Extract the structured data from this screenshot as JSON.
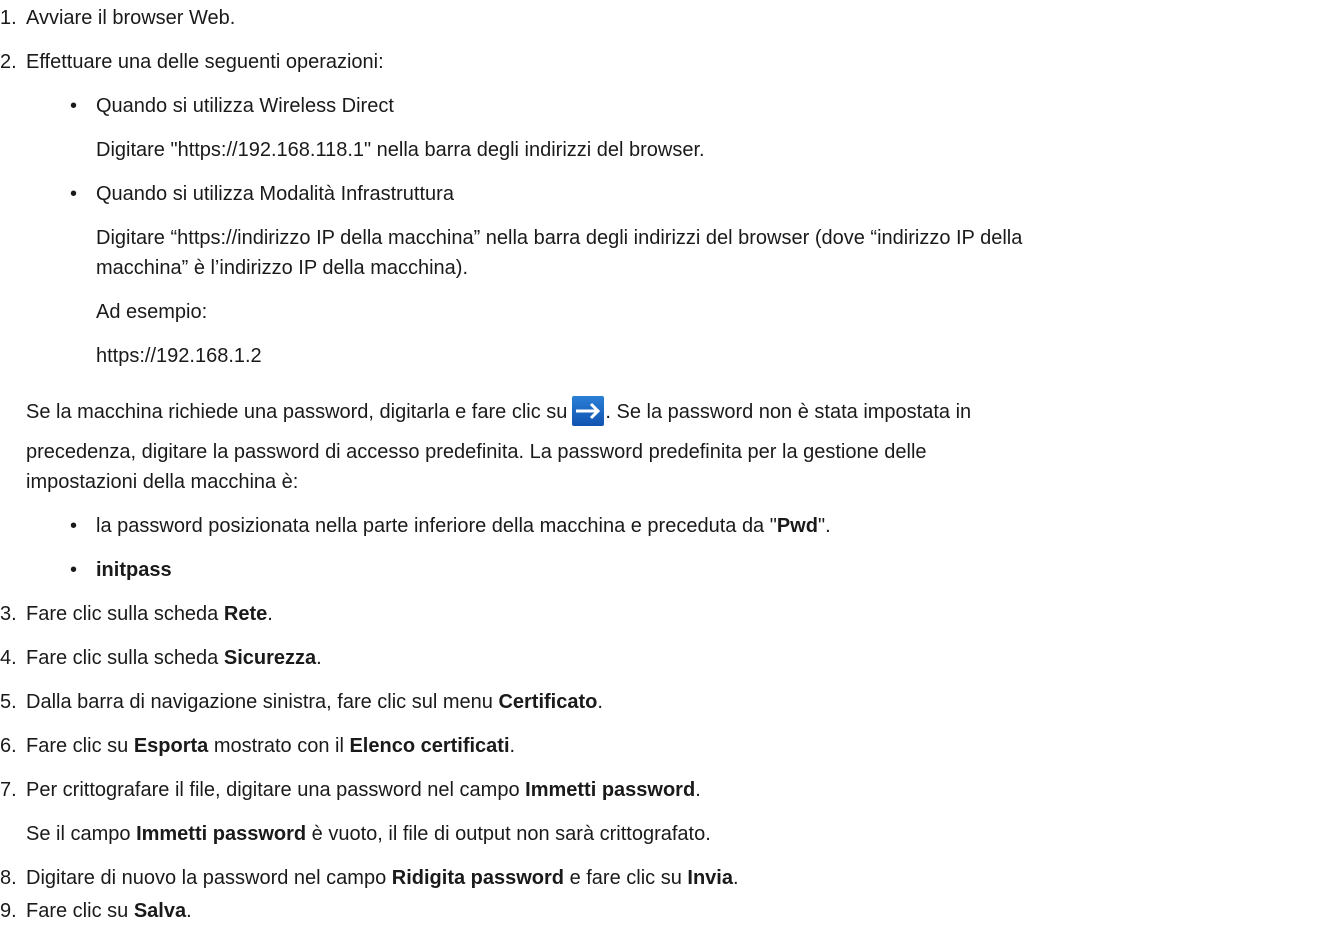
{
  "steps": {
    "s1": {
      "num": "1.",
      "text": "Avviare il browser Web."
    },
    "s2": {
      "num": "2.",
      "text": "Effettuare una delle seguenti operazioni:",
      "opt1_title": "Quando si utilizza Wireless Direct",
      "opt1_desc": "Digitare \"https://192.168.118.1\" nella barra degli indirizzi del browser.",
      "opt2_title": "Quando si utilizza Modalità Infrastruttura",
      "opt2_desc_1": "Digitare “https://indirizzo IP della macchina” nella barra degli indirizzi del browser (dove “indirizzo IP della",
      "opt2_desc_2": "macchina” è l’indirizzo IP della macchina).",
      "example_label": "Ad esempio:",
      "example_url": "https://192.168.1.2",
      "pwd_text_a": "Se la macchina richiede una password, digitarla e fare clic su",
      "pwd_text_b": ". Se la password non è stata impostata in",
      "pwd_text_c": "precedenza, digitare la password di accesso predefinita. La password predefinita per la gestione delle",
      "pwd_text_d": "impostazioni della macchina è:",
      "bullet1_a": "la password posizionata nella parte inferiore della macchina e preceduta da \"",
      "bullet1_b": "Pwd",
      "bullet1_c": "\".",
      "bullet2": "initpass"
    },
    "s3": {
      "num": "3.",
      "a": "Fare clic sulla scheda ",
      "b": "Rete",
      "c": "."
    },
    "s4": {
      "num": "4.",
      "a": "Fare clic sulla scheda ",
      "b": "Sicurezza",
      "c": "."
    },
    "s5": {
      "num": "5.",
      "a": "Dalla barra di navigazione sinistra, fare clic sul menu ",
      "b": "Certificato",
      "c": "."
    },
    "s6": {
      "num": "6.",
      "a": "Fare clic su ",
      "b": "Esporta",
      "c": " mostrato con il ",
      "d": "Elenco certificati",
      "e": "."
    },
    "s7": {
      "num": "7.",
      "a": "Per crittografare il file, digitare una password nel campo ",
      "b": "Immetti password",
      "c": ".",
      "note_a": "Se il campo ",
      "note_b": "Immetti password",
      "note_c": " è vuoto, il file di output non sarà crittografato."
    },
    "s8": {
      "num": "8.",
      "a": "Digitare di nuovo la password nel campo ",
      "b": "Ridigita password",
      "c": " e fare clic su ",
      "d": "Invia",
      "e": "."
    },
    "s9": {
      "num": "9.",
      "a": "Fare clic su ",
      "b": "Salva",
      "c": "."
    }
  },
  "bullet_glyph": "•",
  "icons": {
    "submit_arrow": "arrow-right-icon"
  },
  "colors": {
    "arrow_button": "#1a63c2",
    "text": "#1a1a1a"
  }
}
